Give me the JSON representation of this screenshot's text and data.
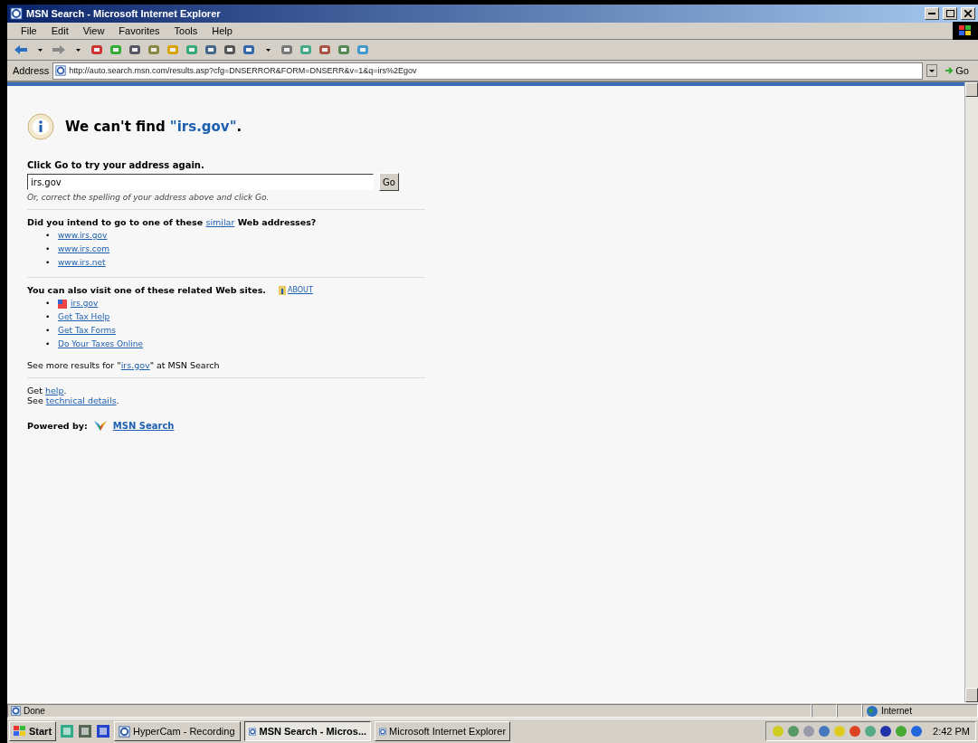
{
  "window": {
    "title": "MSN Search - Microsoft Internet Explorer"
  },
  "menu": [
    "File",
    "Edit",
    "View",
    "Favorites",
    "Tools",
    "Help"
  ],
  "address_bar": {
    "label": "Address",
    "value": "http://auto.search.msn.com/results.asp?cfg=DNSERROR&FORM=DNSERR&v=1&q=irs%2Egov",
    "go": "Go"
  },
  "page": {
    "heading": {
      "before": "We can't find ",
      "highlight": "\"irs.gov\"",
      "after": "."
    },
    "retry": {
      "label": "Click Go to try your address again.",
      "value": "irs.gov",
      "button": "Go",
      "hint": "Or, correct the spelling of your address above and click Go."
    },
    "similar": {
      "before": "Did you intend to go to one of these ",
      "link": "similar",
      "after": " Web addresses?",
      "links": [
        {
          "bullet": "•",
          "label": "www.irs.gov"
        },
        {
          "bullet": "•",
          "label": "www.irs.com"
        },
        {
          "bullet": "•",
          "label": "www.irs.net"
        }
      ]
    },
    "related": {
      "title": "You can also visit one of these related Web sites.",
      "about": "ABOUT",
      "links": [
        {
          "bullet": "•",
          "label": "irs.gov",
          "kind": "flag"
        },
        {
          "bullet": "•",
          "label": "Get Tax Help",
          "kind": "plain"
        },
        {
          "bullet": "•",
          "label": "Get Tax Forms",
          "kind": "plain"
        },
        {
          "bullet": "•",
          "label": "Do Your Taxes Online",
          "kind": "plain"
        }
      ]
    },
    "more": {
      "before": "See more results for \"",
      "link": "irs.gov",
      "after": "\" at MSN Search"
    },
    "help": [
      {
        "before": "Get ",
        "link": "help",
        "after": "."
      },
      {
        "before": "See ",
        "link": "technical details",
        "after": "."
      }
    ],
    "powered": {
      "label": "Powered by:",
      "link": "MSN Search"
    }
  },
  "status_bar": {
    "text": "Done",
    "zone": "Internet"
  },
  "taskbar": {
    "start": "Start",
    "tasks": [
      {
        "label": "HyperCam - Recording",
        "selected": false
      },
      {
        "label": "MSN Search - Micros...",
        "selected": true
      },
      {
        "label": "Microsoft Internet Explorer",
        "selected": false
      }
    ],
    "clock": "2:42 PM"
  }
}
